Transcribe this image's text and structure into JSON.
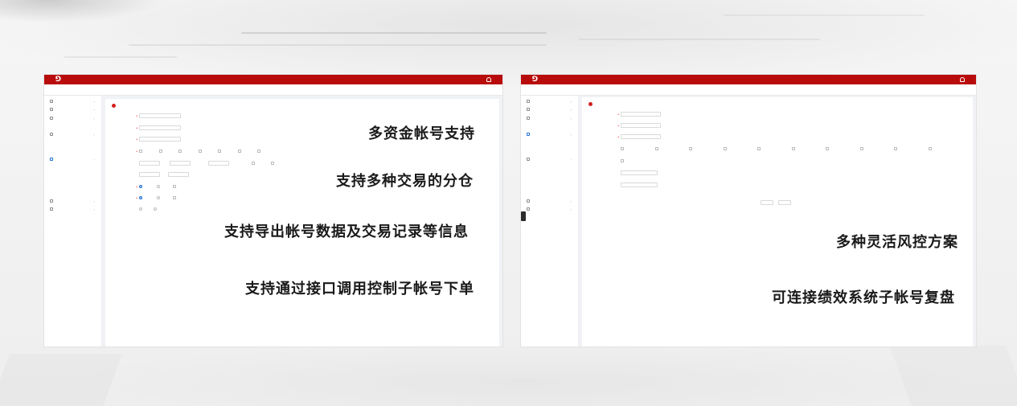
{
  "left_app": {
    "logo_text": "",
    "user": "",
    "sidebar_title": "",
    "breadcrumb": "",
    "page_title": "",
    "sidebar": [
      {
        "label": "",
        "icon": "product-icon",
        "has_chevron": true
      },
      {
        "label": "",
        "icon": "product-icon",
        "has_chevron": true
      },
      {
        "label": "",
        "icon": "account-icon",
        "has_chevron": true
      },
      {
        "label": "",
        "sub": true
      },
      {
        "label": "",
        "icon": "risk-icon",
        "has_chevron": true
      },
      {
        "label": "",
        "sub": true
      },
      {
        "label": "",
        "sub": true
      },
      {
        "label": "",
        "icon": "subaccount-icon",
        "has_chevron": true,
        "active": true
      },
      {
        "label": "",
        "sub": true,
        "active": true
      },
      {
        "label": "",
        "sub": true
      },
      {
        "label": "",
        "sub": true
      },
      {
        "label": "",
        "sub": true
      },
      {
        "label": "",
        "icon": "trade-icon",
        "has_chevron": true
      },
      {
        "label": "",
        "icon": "trade-icon",
        "has_chevron": true
      }
    ],
    "form": {
      "field1_label": "",
      "field1_placeholder": "",
      "field2_label": "",
      "field2_placeholder": "",
      "field3_label": "",
      "field3_placeholder": "",
      "options_label": "",
      "options": [
        "",
        "",
        "",
        "",
        "",
        "",
        ""
      ],
      "row5_label": "",
      "row5_unit1": "",
      "row5_unit2": "",
      "row5_text": "",
      "row5_opt1": "",
      "row5_opt2": "",
      "row6_label": "",
      "row6_unit": "",
      "row6_value": "",
      "row6_suffix": "",
      "row7_label": "",
      "row7_opts": [
        "",
        "",
        ""
      ],
      "row8_label": "",
      "row8_opts": [
        "",
        "",
        ""
      ],
      "row9_label": "",
      "row9_opts": [
        "",
        ""
      ],
      "row9_note": ""
    }
  },
  "right_app": {
    "logo_text": "",
    "user": "",
    "sidebar_title": "",
    "breadcrumb": "",
    "page_title": "",
    "sidebar": [
      {
        "label": "",
        "icon": "product-icon",
        "has_chevron": true
      },
      {
        "label": "",
        "icon": "product-icon",
        "has_chevron": true
      },
      {
        "label": "",
        "icon": "account-icon",
        "has_chevron": true
      },
      {
        "label": "",
        "sub": true
      },
      {
        "label": "",
        "icon": "risk-icon",
        "has_chevron": true,
        "active": true
      },
      {
        "label": "",
        "sub": true
      },
      {
        "label": "",
        "sub": true,
        "active": true
      },
      {
        "label": "",
        "icon": "subaccount-icon",
        "has_chevron": true
      },
      {
        "label": "",
        "sub": true
      },
      {
        "label": "",
        "sub": true
      },
      {
        "label": "",
        "sub": true
      },
      {
        "label": "",
        "sub": true
      },
      {
        "label": "",
        "icon": "trade-icon",
        "has_chevron": true
      },
      {
        "label": "",
        "icon": "trade-icon",
        "has_chevron": true
      }
    ],
    "form": {
      "sel1_label": "",
      "sel1_value": "",
      "sel2_label": "",
      "sel2_value": "",
      "sel3_label": "",
      "sel3_value": "",
      "scope_label": "",
      "scope_opts": [
        "",
        "",
        "",
        "",
        "",
        "",
        "",
        "",
        "",
        ""
      ],
      "type_label": "",
      "type_value": "",
      "level1_label": "",
      "level1_value": "",
      "level1_unit": "",
      "level1_note": "",
      "level2_label": "",
      "level2_value": "",
      "level2_unit": "",
      "btn_back": "",
      "btn_save": ""
    }
  },
  "features": {
    "multi_fund_accounts": "多资金帐号支持",
    "multi_trade_split": "支持多种交易的分仓",
    "export_records": "支持导出帐号数据及交易记录等信息",
    "api_order": "支持通过接口调用控制子帐号下单",
    "risk_control": "多种灵活风控方案",
    "performance_review": "可连接绩效系统子帐号复盘"
  },
  "colors": {
    "header_red": "#b80c0c",
    "accent_blue": "#1f6fd8",
    "title_marker": "#d42020",
    "caption_text": "#1a1a1a"
  }
}
